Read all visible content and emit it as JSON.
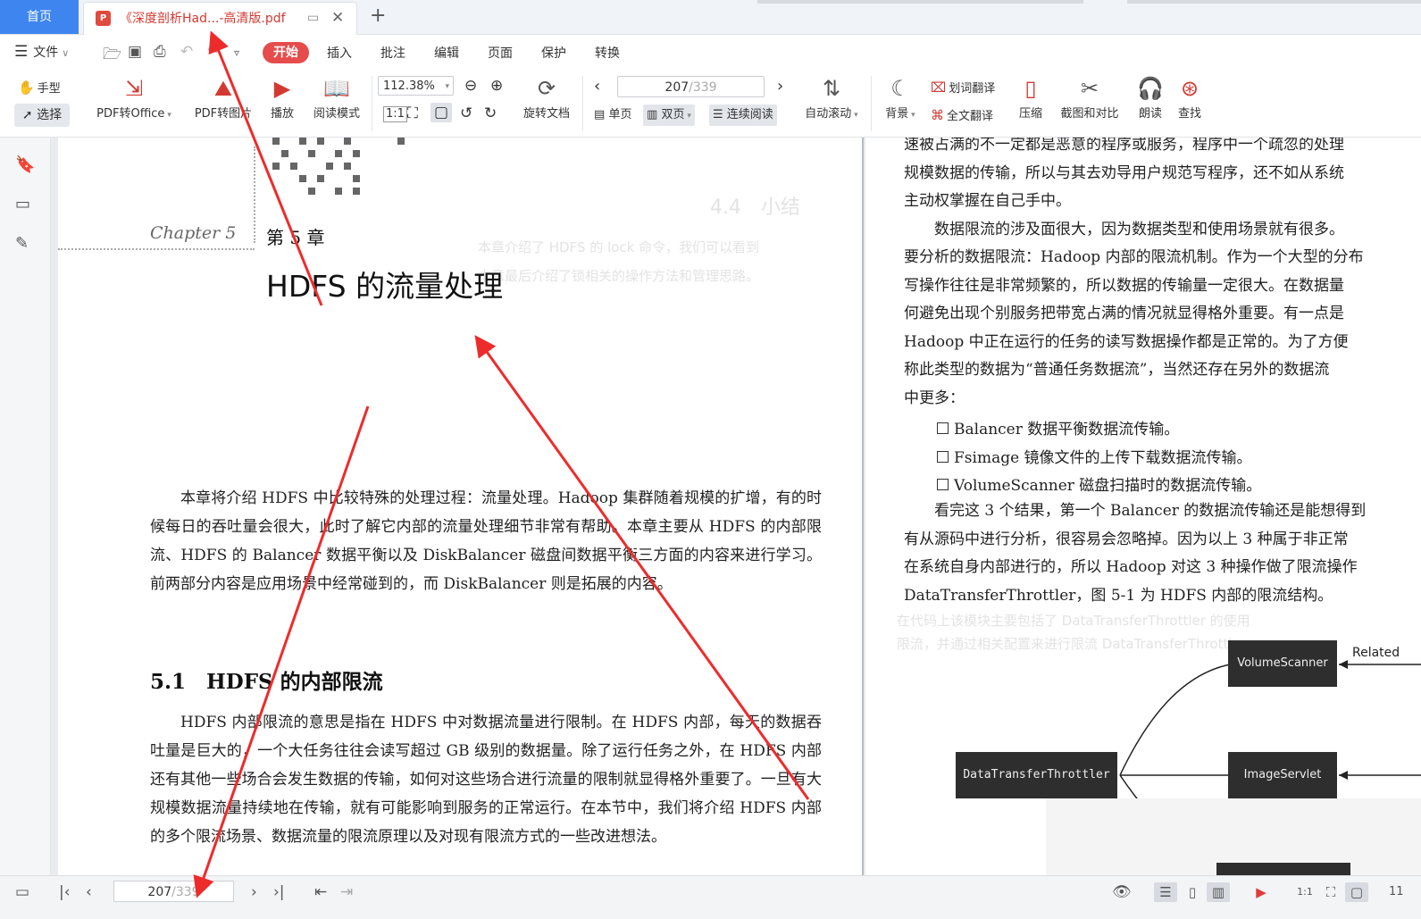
{
  "tabs": {
    "home": "首页",
    "doc_title": "《深度剖析Had...-高清版.pdf"
  },
  "menu": {
    "file": "文件",
    "tabs": [
      "开始",
      "插入",
      "批注",
      "编辑",
      "页面",
      "保护",
      "转换"
    ],
    "active_tab": "开始"
  },
  "ribbon": {
    "hand": "手型",
    "select": "选择",
    "pdf_to_office": "PDF转Office",
    "pdf_to_image": "PDF转图片",
    "play": "播放",
    "read_mode": "阅读模式",
    "zoom": "112.38%",
    "rotate": "旋转文档",
    "page_current": "207",
    "page_total": "/339",
    "single": "单页",
    "double": "双页",
    "continuous": "连续阅读",
    "auto_scroll": "自动滚动",
    "background": "背景",
    "word_translate": "划词翻译",
    "full_translate": "全文翻译",
    "compress": "压缩",
    "screenshot_compare": "截图和对比",
    "read_aloud": "朗读",
    "find": "查找"
  },
  "left_page": {
    "chapter_script": "Chapter 5",
    "chapter_num": "第 5 章",
    "chapter_title": "HDFS 的流量处理",
    "intro": "本章将介绍 HDFS 中比较特殊的处理过程：流量处理。Hadoop 集群随着规模的扩增，有的时候每日的吞吐量会很大，此时了解它内部的流量处理细节非常有帮助。本章主要从 HDFS 的内部限流、HDFS 的 Balancer 数据平衡以及 DiskBalancer 磁盘间数据平衡三方面的内容来进行学习。前两部分内容是应用场景中经常碰到的，而 DiskBalancer 则是拓展的内容。",
    "section_title": "5.1　HDFS 的内部限流",
    "section_body": "HDFS 内部限流的意思是指在 HDFS 中对数据流量进行限制。在 HDFS 内部，每天的数据吞吐量是巨大的，一个大任务往往会读写超过 GB 级别的数据量。除了运行任务之外，在 HDFS 内部还有其他一些场合会发生数据的传输，如何对这些场合进行流量的限制就显得格外重要了。一旦有大规模数据流量持续地在传输，就有可能影响到服务的正常运行。在本节中，我们将介绍 HDFS 内部的多个限流场景、数据流量的限流原理以及对现有限流方式的一些改进想法。"
  },
  "right_page": {
    "lines": [
      "速被占满的不一定都是恶意的程序或服务，程序中一个疏忽的处理",
      "规模数据的传输，所以与其去劝导用户规范写程序，还不如从系统",
      "主动权掌握在自己手中。",
      "　　数据限流的涉及面很大，因为数据类型和使用场景就有很多。",
      "要分析的数据限流：Hadoop 内部的限流机制。作为一个大型的分布",
      "写操作往往是非常频繁的，所以数据的传输量一定很大。在数据量",
      "何避免出现个别服务把带宽占满的情况就显得格外重要。有一点是",
      "Hadoop 中正在运行的任务的读写数据操作都是正常的。为了方便",
      "称此类型的数据为“普通任务数据流”，当然还存在另外的数据流",
      "中更多："
    ],
    "bullets": [
      "Balancer 数据平衡数据流传输。",
      "Fsimage 镜像文件的上传下载数据流传输。",
      "VolumeScanner 磁盘扫描时的数据流传输。"
    ],
    "lines2": [
      "　　看完这 3 个结果，第一个 Balancer 的数据流传输还是能想得到",
      "有从源码中进行分析，很容易会忽略掉。因为以上 3 种属于非正常",
      "在系统自身内部进行的，所以 Hadoop 对这 3 种操作做了限流操作",
      "DataTransferThrottler，图 5-1 为 HDFS 内部的限流结构。"
    ],
    "diagram": {
      "root": "DataTransferThrottler",
      "nodes": [
        "VolumeScanner",
        "ImageServlet"
      ],
      "related": "Related"
    }
  },
  "status": {
    "page_current": "207",
    "page_total": "/339",
    "extra": "11"
  },
  "colors": {
    "accent_blue": "#3e85f0",
    "accent_red": "#e64c4c",
    "annotation_red": "#ee2b2b"
  }
}
